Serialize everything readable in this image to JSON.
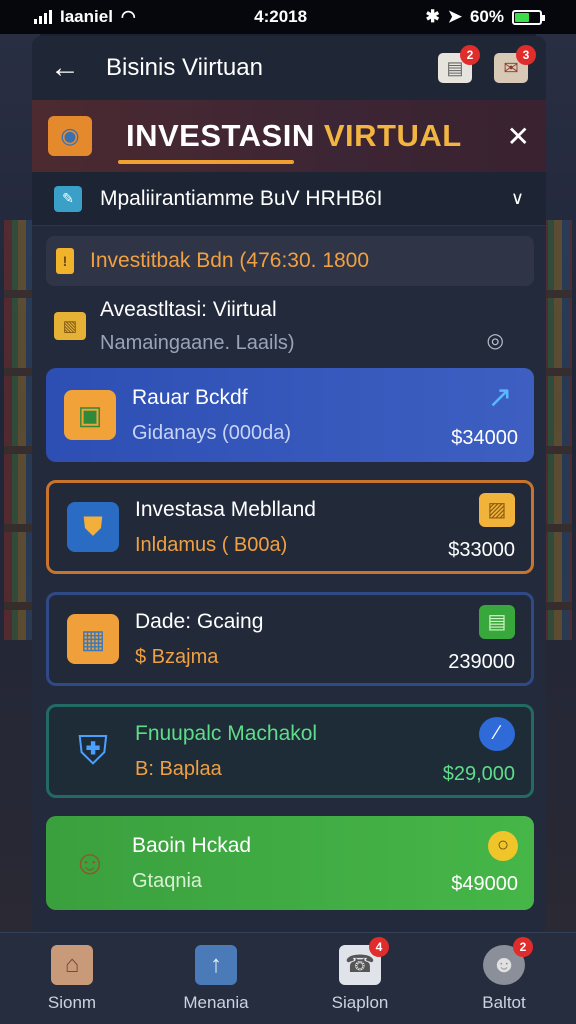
{
  "status_bar": {
    "carrier": "Iaaniel",
    "time": "4:2018",
    "battery": "60%",
    "battery_level": 0.6
  },
  "header": {
    "title": "Bisinis Viirtuan",
    "notifications_badge": "2",
    "mail_badge": "3"
  },
  "banner": {
    "title_main": "INVESTASIN ",
    "title_accent": "VIRTUAL"
  },
  "selector": {
    "label": "Mpaliirantiamme BuV HRHB6I"
  },
  "invest_info": {
    "text": "Investitbak Bdn (476:30. 1800"
  },
  "summary": {
    "title": "Aveastltasi: Viirtual",
    "subtitle": "Namaingaane. Laails)"
  },
  "cards": [
    {
      "title": "Rauar Bckdf",
      "subtitle": "Gidanays (000da)",
      "amount": "$34000",
      "icon": "money-stack-icon",
      "action_icon": "trending-up-icon"
    },
    {
      "title": "Investasa Meblland",
      "subtitle": "Inldamus ( B00a)",
      "amount": "$33000",
      "icon": "shield-chart-icon",
      "action_icon": "gold-box-icon"
    },
    {
      "title": "Dade: Gcaing",
      "subtitle": "$ Bzajma",
      "amount": "239000",
      "icon": "calculator-icon",
      "action_icon": "wallet-icon"
    },
    {
      "title": "Fnuupalc Machakol",
      "subtitle": "B: Baplaa",
      "amount": "$29,000",
      "icon": "shield-icon",
      "action_icon": "edit-circle-icon"
    },
    {
      "title": "Baoin Hckad",
      "subtitle": "Gtaqnia",
      "amount": "$49000",
      "icon": "farmer-character-icon",
      "action_icon": "coin-icon"
    }
  ],
  "bottom_nav": [
    {
      "label": "Sionm",
      "icon": "home-icon"
    },
    {
      "label": "Menania",
      "icon": "chart-icon",
      "badge": ""
    },
    {
      "label": "Siaplon",
      "icon": "phone-icon",
      "badge": "4"
    },
    {
      "label": "Baltot",
      "icon": "profile-icon",
      "badge": "2"
    }
  ]
}
